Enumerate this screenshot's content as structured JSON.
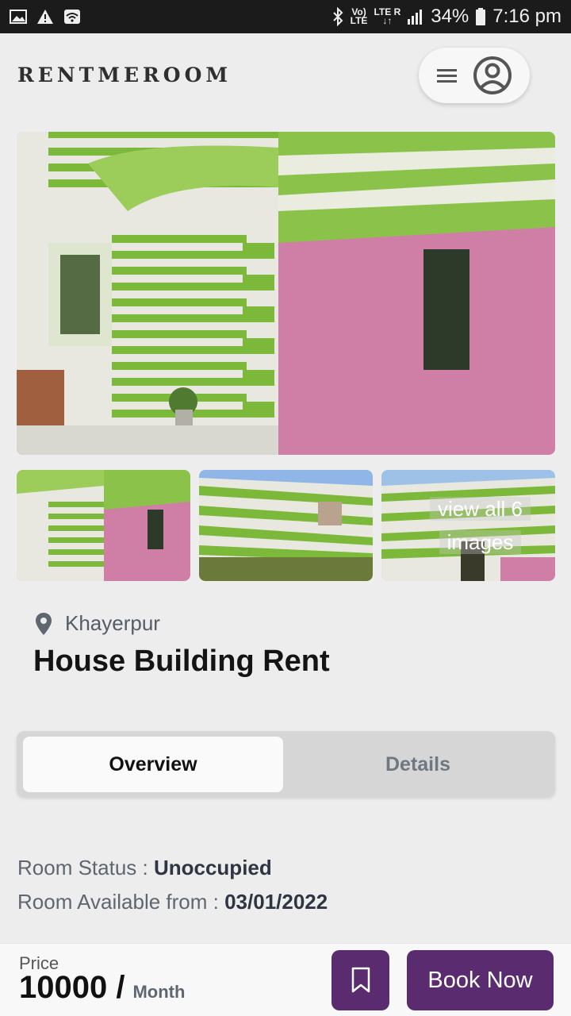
{
  "status_bar": {
    "network_top": "Vo)",
    "network_bottom": "LTE",
    "lte_top": "LTE",
    "lte_r": "R",
    "battery": "34%",
    "time": "7:16 pm",
    "icons": [
      "image-icon",
      "warning-icon",
      "wifi-icon",
      "bluetooth-icon",
      "signal-icon",
      "battery-icon"
    ]
  },
  "header": {
    "brand": "RENTMEROOM",
    "menu_icon": "hamburger-icon",
    "profile_icon": "user-circle-icon"
  },
  "gallery": {
    "view_all_line1": "view all 6",
    "view_all_line2": "images"
  },
  "listing": {
    "location": "Khayerpur",
    "title": "House Building Rent"
  },
  "tabs": {
    "overview": "Overview",
    "details": "Details",
    "active": "Overview"
  },
  "info": {
    "status_label": "Room Status : ",
    "status_value": "Unoccupied",
    "available_label": "Room Available from : ",
    "available_value": "03/01/2022"
  },
  "bottom": {
    "price_label": "Price",
    "price_value": "10000 /",
    "price_unit": "Month",
    "book_label": "Book Now",
    "bookmark_icon": "bookmark-icon"
  },
  "colors": {
    "accent": "#5a2b6e",
    "background": "#ededed",
    "wall_green": "#7cb83a",
    "wall_pink": "#cf7ea5"
  }
}
